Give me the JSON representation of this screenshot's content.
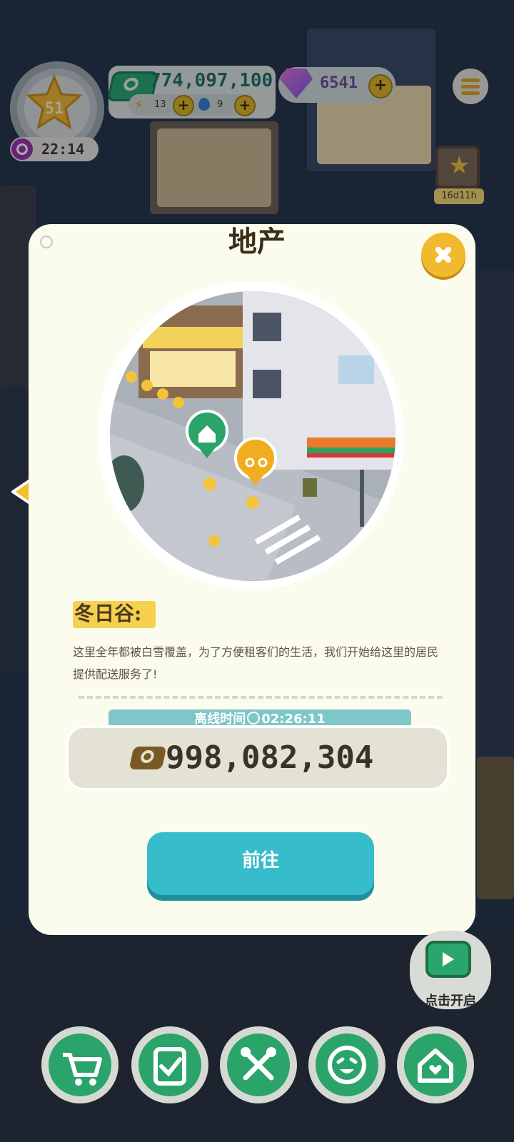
{
  "hud": {
    "level": "51",
    "level_timer": "22:14",
    "money": "774,097,100",
    "energy": "13",
    "water": "9",
    "gems": "6541",
    "event_timer": "16d11h"
  },
  "modal": {
    "title": "地产",
    "place_name": "冬日谷:",
    "description": "这里全年都被白雪覆盖，为了方便租客们的生活，我们开始给这里的居民提供配送服务了!",
    "offline_label": "离线时间",
    "offline_time": "02:26:11",
    "reward": "998,082,304",
    "go_button": "前往"
  },
  "widget": {
    "tv_label": "点击开启"
  },
  "bottom_bar": [
    "cart-icon",
    "clipboard-check-icon",
    "tools-icon",
    "laugh-face-icon",
    "house-heart-icon"
  ],
  "colors": {
    "primary_green": "#2aa46a",
    "teal_button": "#36bccb",
    "gold": "#f2b82e",
    "modal_bg": "#fbfbee"
  }
}
